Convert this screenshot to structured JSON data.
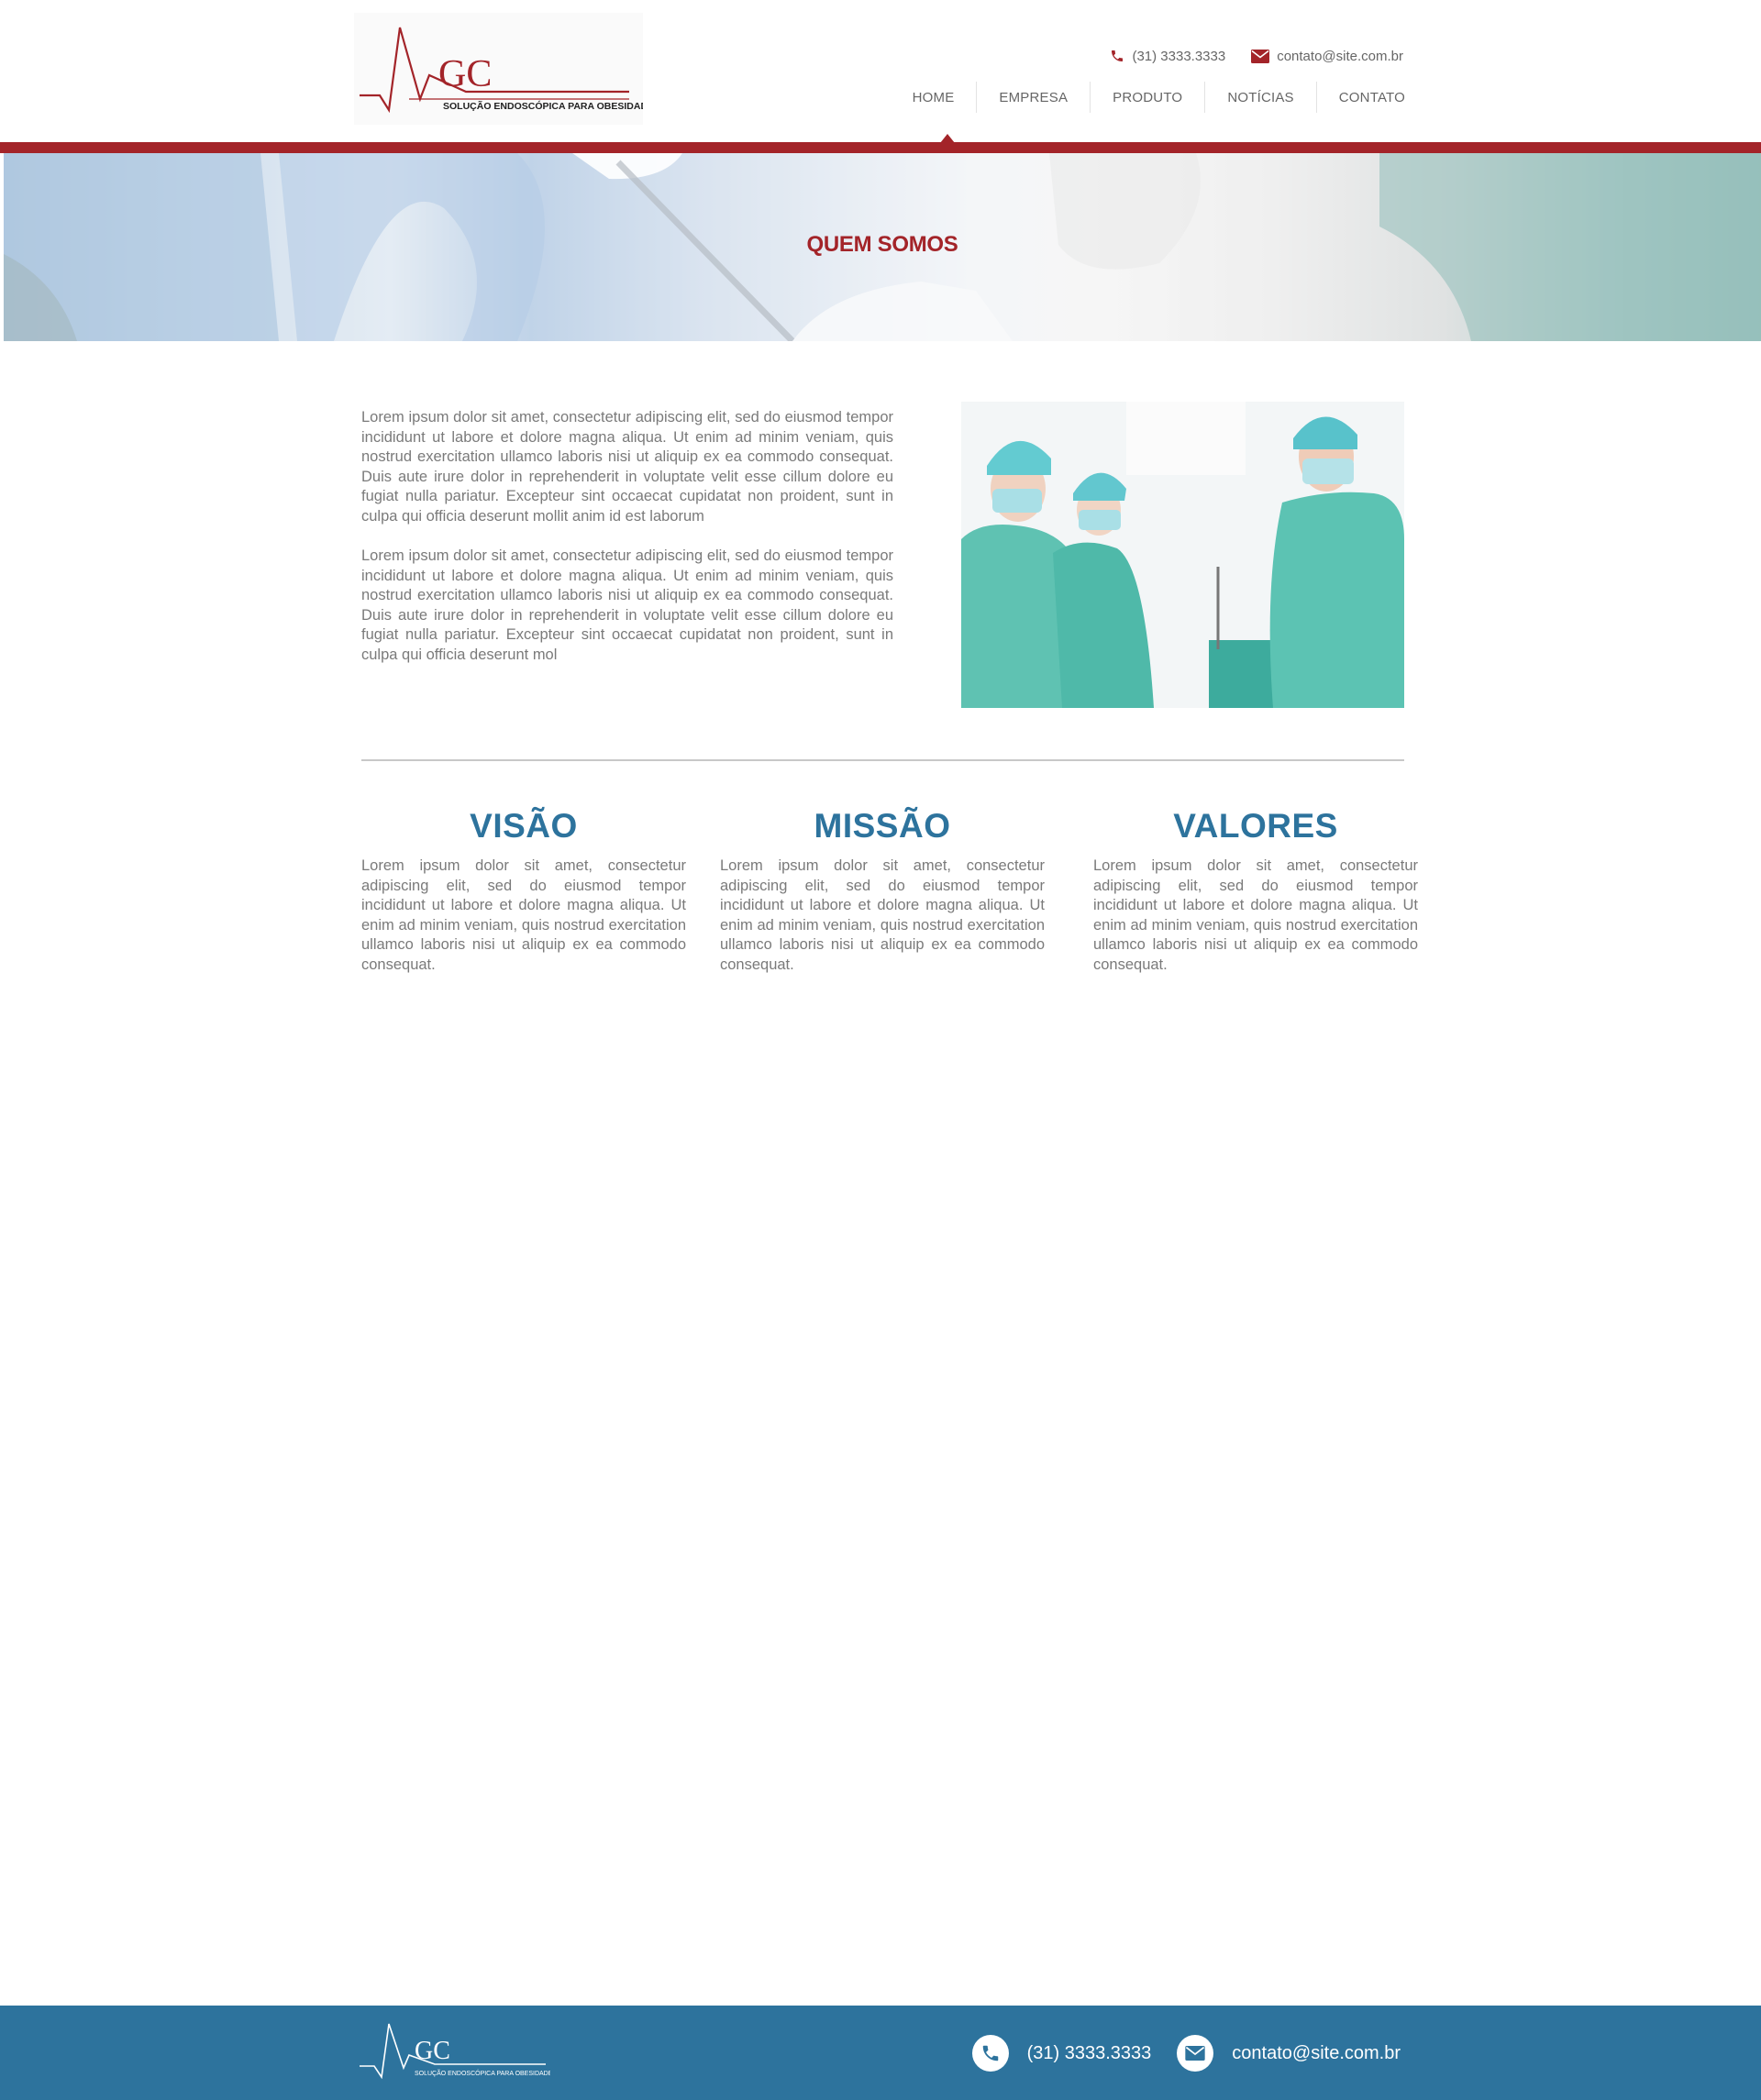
{
  "header": {
    "logo_letters": "GC",
    "logo_tagline": "SOLUÇÃO ENDOSCÓPICA PARA OBESIDADE",
    "phone": "(31) 3333.3333",
    "email": "contato@site.com.br",
    "nav": [
      "HOME",
      "EMPRESA",
      "PRODUTO",
      "NOTÍCIAS",
      "CONTATO"
    ],
    "active_nav": "HOME"
  },
  "banner": {
    "title": "QUEM SOMOS"
  },
  "intro": {
    "paragraphs": [
      "Lorem ipsum dolor sit amet, consectetur adipiscing elit, sed do eiusmod tempor incididunt ut labore et dolore magna aliqua. Ut enim ad minim veniam, quis nostrud exercitation ullamco laboris nisi ut aliquip ex ea commodo consequat. Duis aute irure dolor in reprehenderit in voluptate velit esse cillum dolore eu fugiat nulla pariatur. Excepteur sint occaecat cupidatat non proident, sunt in culpa qui officia deserunt mollit anim id est laborum",
      "Lorem ipsum dolor sit amet, consectetur adipiscing elit, sed do eiusmod tempor incididunt ut labore et dolore magna aliqua. Ut enim ad minim veniam, quis nostrud exercitation ullamco laboris nisi ut aliquip ex ea commodo consequat. Duis aute irure dolor in reprehenderit in voluptate velit esse cillum dolore eu fugiat nulla pariatur. Excepteur sint occaecat cupidatat non proident, sunt in culpa qui officia deserunt mol"
    ]
  },
  "columns": [
    {
      "title": "VISÃO",
      "text": "Lorem ipsum dolor sit amet, consectetur adipiscing elit, sed do eiusmod tempor incididunt ut labore et dolore magna aliqua. Ut enim ad minim veniam, quis nostrud exercitation ullamco laboris nisi ut aliquip ex ea commodo consequat."
    },
    {
      "title": "MISSÃO",
      "text": "Lorem ipsum dolor sit amet, consectetur adipiscing elit, sed do eiusmod tempor incididunt ut labore et dolore magna aliqua. Ut enim ad minim veniam, quis nostrud exercitation ullamco laboris nisi ut aliquip ex ea commodo consequat."
    },
    {
      "title": "VALORES",
      "text": "Lorem ipsum dolor sit amet, consectetur adipiscing elit, sed do eiusmod tempor incididunt ut labore et dolore magna aliqua. Ut enim ad minim veniam, quis nostrud exercitation ullamco laboris nisi ut aliquip ex ea commodo consequat."
    }
  ],
  "footer": {
    "logo_letters": "GC",
    "logo_tagline": "SOLUÇÃO ENDOSCÓPICA PARA OBESIDADE",
    "phone": "(31) 3333.3333",
    "email": "contato@site.com.br"
  },
  "colors": {
    "brand_red": "#a32429",
    "brand_blue": "#2d739d",
    "body_text": "#7a7a7a"
  },
  "icons": {
    "phone": "phone-icon",
    "email": "envelope-icon"
  }
}
